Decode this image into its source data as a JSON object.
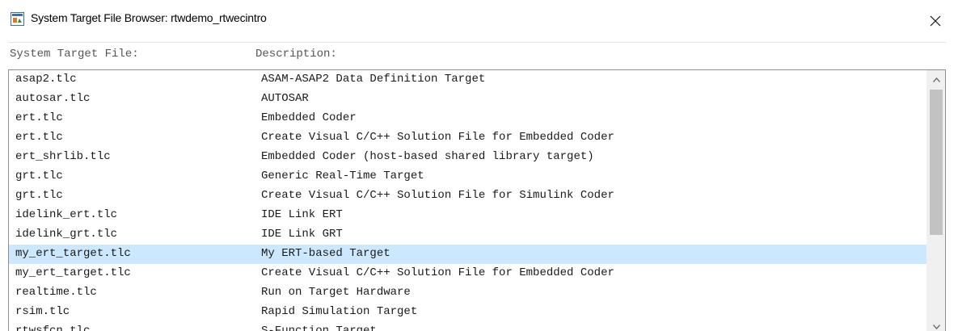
{
  "window": {
    "title": "System Target File Browser: rtwdemo_rtwecintro"
  },
  "headers": {
    "file": "System Target File:",
    "description": "Description:"
  },
  "rows": [
    {
      "file": "asap2.tlc",
      "description": "ASAM-ASAP2 Data Definition Target"
    },
    {
      "file": "autosar.tlc",
      "description": "AUTOSAR"
    },
    {
      "file": "ert.tlc",
      "description": "Embedded Coder"
    },
    {
      "file": "ert.tlc",
      "description": "Create Visual C/C++ Solution File for Embedded Coder"
    },
    {
      "file": "ert_shrlib.tlc",
      "description": "Embedded Coder (host-based shared library target)"
    },
    {
      "file": "grt.tlc",
      "description": "Generic Real-Time Target"
    },
    {
      "file": "grt.tlc",
      "description": "Create Visual C/C++ Solution File for Simulink Coder"
    },
    {
      "file": "idelink_ert.tlc",
      "description": "IDE Link ERT"
    },
    {
      "file": "idelink_grt.tlc",
      "description": "IDE Link GRT"
    },
    {
      "file": "my_ert_target.tlc",
      "description": "My ERT-based Target"
    },
    {
      "file": "my_ert_target.tlc",
      "description": "Create Visual C/C++ Solution File for Embedded Coder"
    },
    {
      "file": "realtime.tlc",
      "description": "Run on Target Hardware"
    },
    {
      "file": "rsim.tlc",
      "description": "Rapid Simulation Target"
    },
    {
      "file": "rtwsfcn.tlc",
      "description": "S-Function Target"
    }
  ],
  "selected_row": 9,
  "icons": {
    "app": "simulink-app-icon",
    "close": "close-icon",
    "scroll_up": "scroll-up-arrow-icon",
    "scroll_down": "scroll-down-arrow-icon"
  },
  "colors": {
    "selection": "#cce8ff",
    "scroll_thumb": "#c2c2c2"
  }
}
